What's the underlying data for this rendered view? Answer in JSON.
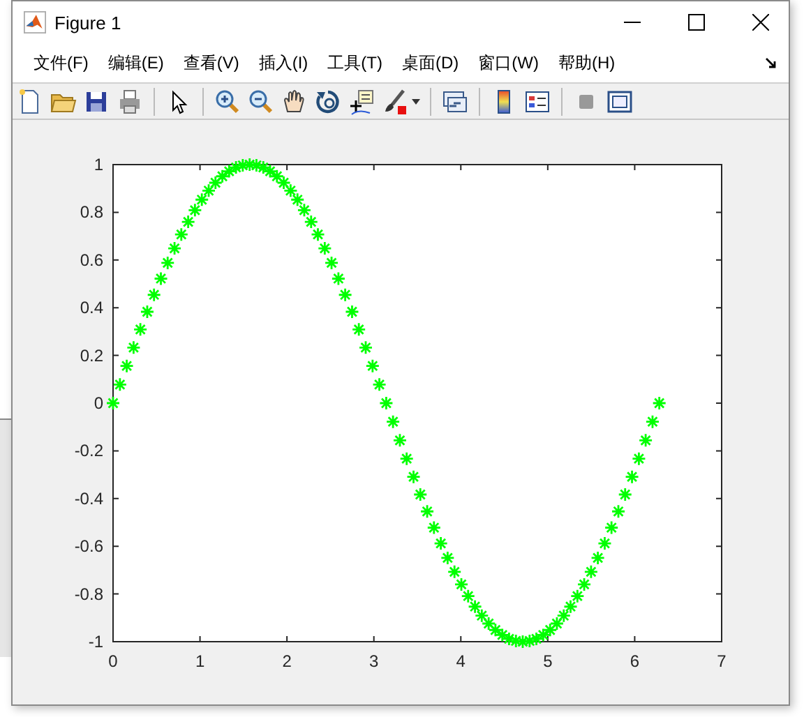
{
  "window": {
    "title": "Figure 1"
  },
  "menu": [
    "文件(F)",
    "编辑(E)",
    "查看(V)",
    "插入(I)",
    "工具(T)",
    "桌面(D)",
    "窗口(W)",
    "帮助(H)"
  ],
  "toolbar": [
    {
      "kind": "new"
    },
    {
      "kind": "open"
    },
    {
      "kind": "save"
    },
    {
      "kind": "print"
    },
    {
      "kind": "sep"
    },
    {
      "kind": "pointer"
    },
    {
      "kind": "sep"
    },
    {
      "kind": "zoom-in"
    },
    {
      "kind": "zoom-out"
    },
    {
      "kind": "pan"
    },
    {
      "kind": "rotate"
    },
    {
      "kind": "datatip"
    },
    {
      "kind": "brush"
    },
    {
      "kind": "sep"
    },
    {
      "kind": "link"
    },
    {
      "kind": "sep"
    },
    {
      "kind": "colorbar"
    },
    {
      "kind": "legend"
    },
    {
      "kind": "sep"
    },
    {
      "kind": "hide"
    },
    {
      "kind": "show"
    }
  ],
  "plot": {
    "chart_data": {
      "type": "scatter",
      "xlim": [
        0,
        7
      ],
      "ylim": [
        -1,
        1
      ],
      "xticks": [
        0,
        1,
        2,
        3,
        4,
        5,
        6,
        7
      ],
      "yticks": [
        -1,
        -0.8,
        -0.6,
        -0.4,
        -0.2,
        0,
        0.2,
        0.4,
        0.6,
        0.8,
        1
      ],
      "x": [
        0,
        0.079,
        0.157,
        0.236,
        0.314,
        0.393,
        0.471,
        0.55,
        0.628,
        0.707,
        0.785,
        0.864,
        0.942,
        1.021,
        1.1,
        1.178,
        1.257,
        1.335,
        1.414,
        1.492,
        1.571,
        1.649,
        1.728,
        1.806,
        1.885,
        1.963,
        2.042,
        2.121,
        2.199,
        2.278,
        2.356,
        2.435,
        2.513,
        2.592,
        2.67,
        2.749,
        2.827,
        2.906,
        2.985,
        3.063,
        3.142,
        3.22,
        3.299,
        3.377,
        3.456,
        3.534,
        3.613,
        3.691,
        3.77,
        3.848,
        3.927,
        4.006,
        4.084,
        4.163,
        4.241,
        4.32,
        4.398,
        4.477,
        4.555,
        4.634,
        4.712,
        4.791,
        4.869,
        4.948,
        5.027,
        5.105,
        5.184,
        5.262,
        5.341,
        5.419,
        5.498,
        5.576,
        5.655,
        5.733,
        5.812,
        5.89,
        5.969,
        6.048,
        6.126,
        6.205,
        6.283
      ],
      "series": [
        {
          "marker": "cross",
          "color": "#00ff00",
          "values": [
            0,
            0.078,
            0.156,
            0.233,
            0.309,
            0.383,
            0.454,
            0.522,
            0.588,
            0.649,
            0.707,
            0.76,
            0.809,
            0.853,
            0.891,
            0.924,
            0.951,
            0.972,
            0.988,
            0.997,
            1,
            0.997,
            0.988,
            0.972,
            0.951,
            0.924,
            0.891,
            0.853,
            0.809,
            0.76,
            0.707,
            0.649,
            0.588,
            0.522,
            0.454,
            0.383,
            0.309,
            0.233,
            0.156,
            0.078,
            0,
            -0.078,
            -0.156,
            -0.233,
            -0.309,
            -0.383,
            -0.454,
            -0.522,
            -0.588,
            -0.649,
            -0.707,
            -0.76,
            -0.809,
            -0.853,
            -0.891,
            -0.924,
            -0.951,
            -0.972,
            -0.988,
            -0.997,
            -1,
            -0.997,
            -0.988,
            -0.972,
            -0.951,
            -0.924,
            -0.891,
            -0.853,
            -0.809,
            -0.76,
            -0.707,
            -0.649,
            -0.588,
            -0.522,
            -0.454,
            -0.383,
            -0.309,
            -0.233,
            -0.156,
            -0.078,
            0
          ]
        }
      ]
    }
  }
}
